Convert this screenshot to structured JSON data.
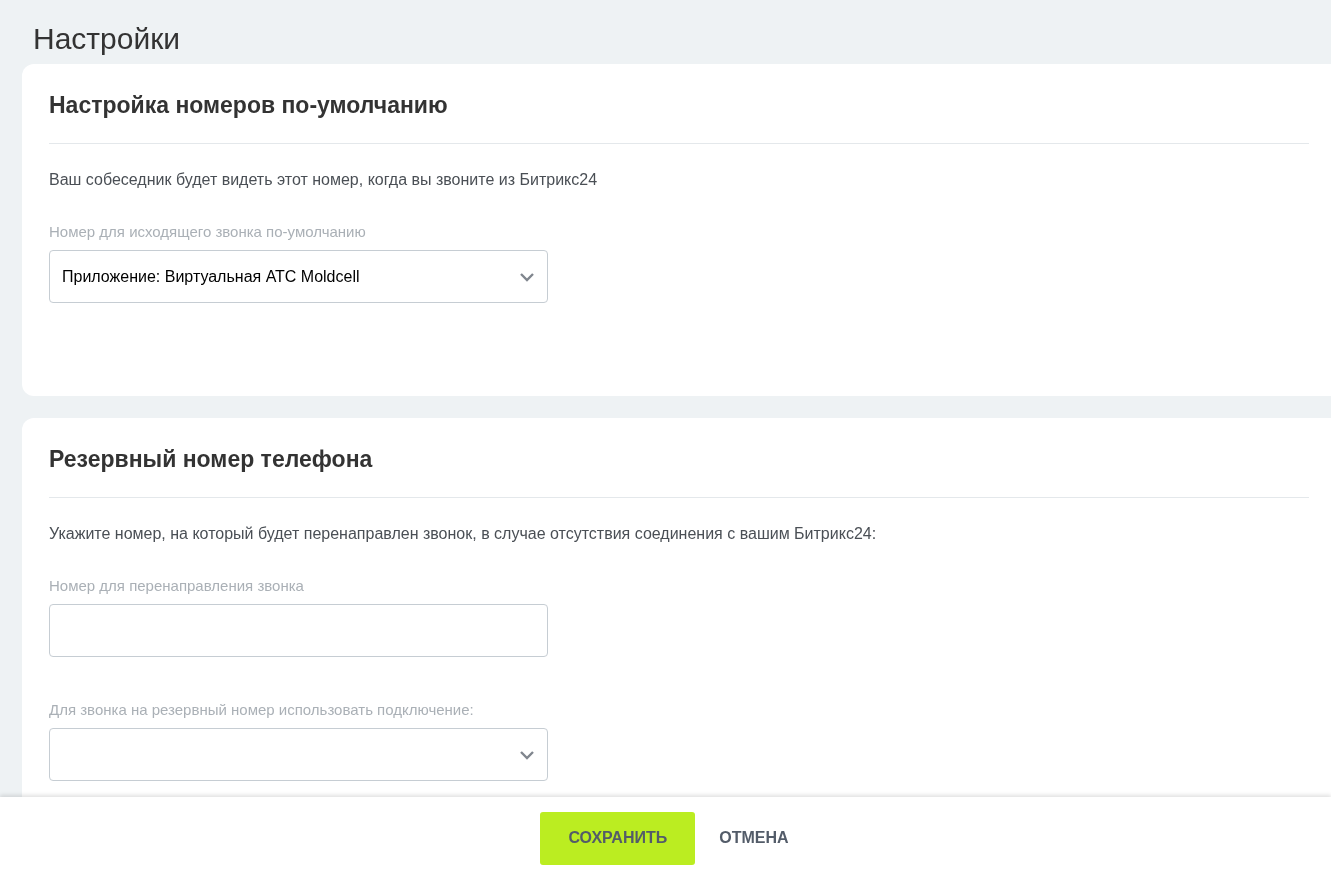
{
  "page_title": "Настройки",
  "sections": [
    {
      "title": "Настройка номеров по-умолчанию",
      "description": "Ваш собеседник будет видеть этот номер, когда вы звоните из Битрикс24",
      "fields": [
        {
          "kind": "select",
          "label": "Номер для исходящего звонка по-умолчанию",
          "value": "Приложение: Виртуальная АТС Moldcell"
        }
      ]
    },
    {
      "title": "Резервный номер телефона",
      "description": "Укажите номер, на который будет перенаправлен звонок, в случае отсутствия соединения с вашим Битрикс24:",
      "fields": [
        {
          "kind": "text",
          "label": "Номер для перенаправления звонка"
        },
        {
          "kind": "select",
          "label": "Для звонка на резервный номер использовать подключение:"
        }
      ]
    }
  ],
  "footer": {
    "buttons": [
      {
        "kind": "primary",
        "label": "СОХРАНИТЬ"
      },
      {
        "kind": "link",
        "label": "ОТМЕНА"
      }
    ]
  }
}
